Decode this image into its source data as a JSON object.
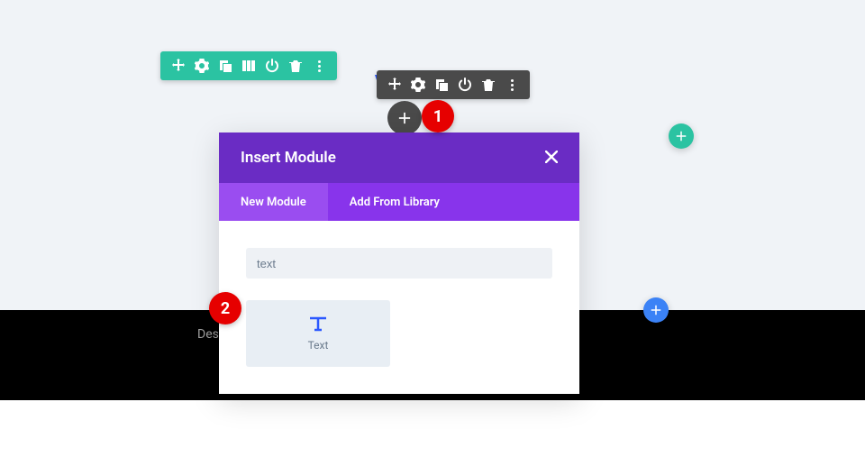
{
  "heading": "V I",
  "footer": "Des",
  "modal": {
    "title": "Insert Module",
    "tabs": {
      "new": "New Module",
      "library": "Add From Library"
    },
    "search_value": "text",
    "module": {
      "label": "Text"
    }
  },
  "annotations": {
    "a1": "1",
    "a2": "2"
  }
}
